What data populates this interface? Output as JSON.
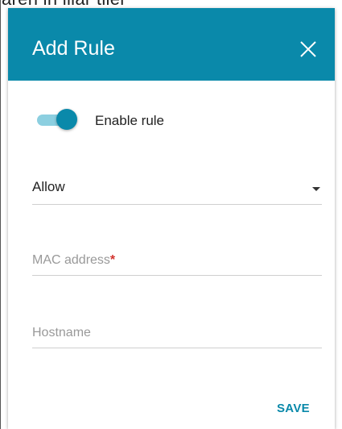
{
  "background": {
    "text": "aren in iliar tiler"
  },
  "dialog": {
    "title": "Add Rule",
    "close_icon": "close-icon",
    "accent_color": "#0a89aa",
    "enable_toggle": {
      "label": "Enable rule",
      "checked": true
    },
    "action_select": {
      "value": "Allow",
      "icon": "caret-down-icon"
    },
    "mac_field": {
      "placeholder": "MAC address",
      "required_marker": "*",
      "value": ""
    },
    "hostname_field": {
      "placeholder": "Hostname",
      "value": ""
    },
    "save_label": "SAVE"
  }
}
